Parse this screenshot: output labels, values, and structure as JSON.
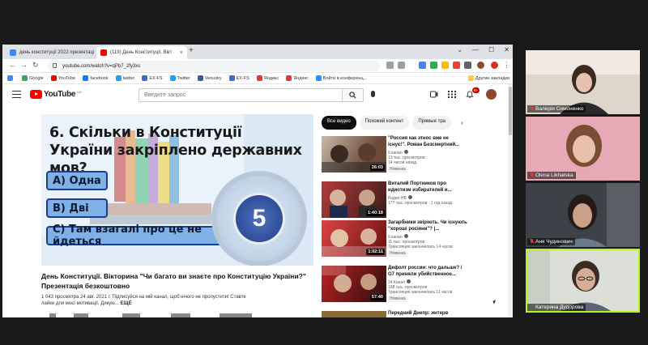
{
  "browser": {
    "tabs": [
      {
        "title": "день конституції 2022 презентаці",
        "favicon_color": "#4285f4"
      },
      {
        "title": "(119) День Конституції. Вікт",
        "favicon_color": "#ff0000"
      }
    ],
    "new_tab_label": "+",
    "url": "youtube.com/watch?v=qPb7_2fy3xs",
    "bookmarks": [
      {
        "label": "",
        "color": "#4285f4"
      },
      {
        "label": "Google",
        "color": "#34a853"
      },
      {
        "label": "YouTube",
        "color": "#ff0000"
      },
      {
        "label": "facebook",
        "color": "#1877f2"
      },
      {
        "label": "twitter",
        "color": "#1da1f2"
      },
      {
        "label": "EX-FS",
        "color": "#3b6ad3"
      },
      {
        "label": "Twitter",
        "color": "#1da1f2"
      },
      {
        "label": "Venusky",
        "color": "#3b5998"
      },
      {
        "label": "EX-FS",
        "color": "#3b6ad3"
      },
      {
        "label": "Яндекс",
        "color": "#e33"
      },
      {
        "label": "Яндекс",
        "color": "#e33"
      },
      {
        "label": "Войти в конференц...",
        "color": "#2d8cff"
      }
    ],
    "bookmarks_other": "Другие закладки"
  },
  "youtube": {
    "logo_text": "YouTube",
    "logo_region": "UA",
    "search_placeholder": "Введите запрос",
    "notifications_count": "9+",
    "video": {
      "question": "6. Скільки в Конституції України закріплено державних мов?",
      "answers": [
        "А) Одна",
        "В) Дві",
        "С) Там взагалі про це не йдеться"
      ],
      "counter": "5",
      "title": "День Конституції. Вікторина \"Чи багато ви знаєте про Конституцію України?\" Презентація безкоштовно",
      "meta_line1": "1 043 просмотра  24 авг. 2021 г.  Підписуйся на мій канал, щоб нічого не пропустити! Ставте",
      "meta_line2": "лайки для моєї мотивації. Дякую...",
      "meta_more": "ЕЩЁ"
    },
    "chips": [
      "Все видео",
      "Похожий контент",
      "Прямые тра"
    ],
    "suggestions": [
      {
        "title": "\"Россия как этнос вже не існує!\". Роман Безсмертний...",
        "channel": "5 канал",
        "stats": "13 тыс. просмотров",
        "stats2": "14 часов назад",
        "badge": "Новинка",
        "duration": "26:03",
        "thumb_color": "#6b4a3a"
      },
      {
        "title": "Виталий Портников про идиотизм избирателей и...",
        "channel": "Радио НВ",
        "stats": "177 тыс. просмотров · 1 год назад",
        "stats2": "",
        "badge": "",
        "duration": "1:40:18",
        "thumb_color": "#7a2e2e"
      },
      {
        "title": "Загарбники звіріють. Чи існують \"хороші росіяни\"? |...",
        "channel": "5 канал",
        "stats": "11 тыс. просмотров",
        "stats2": "Трансляция закончилась 14 часов",
        "badge": "Новинка",
        "duration": "1:02:11",
        "thumb_color": "#b33636"
      },
      {
        "title": "Дефолт россии: что дальше? / G7 приняли убийственное...",
        "channel": "24 Канал",
        "stats": "198 тыс. просмотров",
        "stats2": "Трансляция закончилась 11 часов",
        "badge": "Новинка",
        "duration": "57:40",
        "thumb_color": "#8a1e1e"
      },
      {
        "title": "Передний Днепр: интерв",
        "channel": "",
        "stats": "",
        "stats2": "",
        "badge": "",
        "duration": "",
        "thumb_color": "#3a3a3a"
      }
    ]
  },
  "participants": [
    {
      "name": "Валерія Симоненко",
      "muted": true,
      "bg": "#c9b8a8",
      "face": "#7a5a44"
    },
    {
      "name": "Olena Likhatska",
      "muted": true,
      "bg": "#d79aa8",
      "face": "#b07a62"
    },
    {
      "name": "Аня Чудинович",
      "muted": true,
      "bg": "#4b4f55",
      "face": "#a47d66"
    },
    {
      "name": "Катерина Дудорова",
      "muted": false,
      "bg": "#d9dbd6",
      "face": "#9c7a6a"
    }
  ]
}
